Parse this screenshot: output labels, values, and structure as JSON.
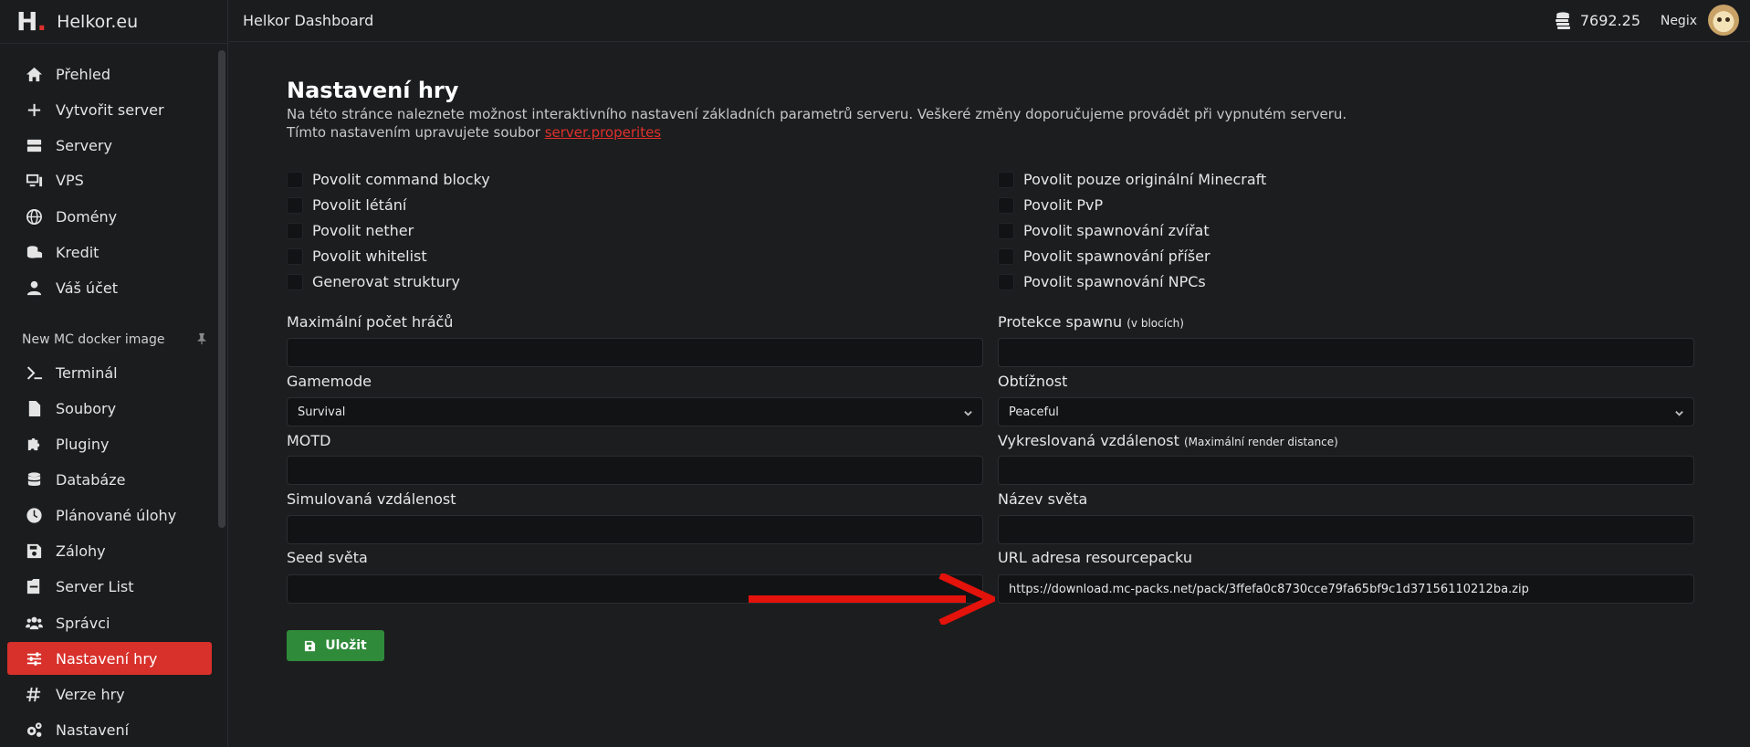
{
  "brand": {
    "logo_letter": "H",
    "logo_dot": ".",
    "name": "Helkor.eu"
  },
  "topbar": {
    "title": "Helkor Dashboard",
    "credit": "7692.25",
    "username": "Negix"
  },
  "sidebar": {
    "items": [
      {
        "label": "Přehled",
        "icon": "home-icon"
      },
      {
        "label": "Vytvořit server",
        "icon": "plus-icon"
      },
      {
        "label": "Servery",
        "icon": "server-icon"
      },
      {
        "label": "VPS",
        "icon": "desktop-icon"
      },
      {
        "label": "Domény",
        "icon": "globe-icon"
      },
      {
        "label": "Kredit",
        "icon": "coins-icon"
      },
      {
        "label": "Váš účet",
        "icon": "user-icon"
      }
    ],
    "section_label": "New MC docker image",
    "server_items": [
      {
        "label": "Terminál",
        "icon": "terminal-icon"
      },
      {
        "label": "Soubory",
        "icon": "file-icon"
      },
      {
        "label": "Pluginy",
        "icon": "puzzle-icon"
      },
      {
        "label": "Databáze",
        "icon": "database-icon"
      },
      {
        "label": "Plánované úlohy",
        "icon": "clock-icon"
      },
      {
        "label": "Zálohy",
        "icon": "save-icon"
      },
      {
        "label": "Server List",
        "icon": "list-icon"
      },
      {
        "label": "Správci",
        "icon": "users-icon"
      },
      {
        "label": "Nastavení hry",
        "icon": "sliders-icon",
        "active": true
      },
      {
        "label": "Verze hry",
        "icon": "hashtag-icon"
      },
      {
        "label": "Nastavení",
        "icon": "cogs-icon"
      }
    ],
    "active_color": "#d8302b"
  },
  "main": {
    "title": "Nastavení hry",
    "desc1": "Na této stránce naleznete možnost interaktivního nastavení základních parametrů serveru. Veškeré změny doporučujeme provádět při vypnutém serveru.",
    "desc2_prefix": "Tímto nastavením upravujete soubor ",
    "desc2_link": "server.properites",
    "checkboxes_left": [
      "Povolit command blocky",
      "Povolit létání",
      "Povolit nether",
      "Povolit whitelist",
      "Generovat struktury"
    ],
    "checkboxes_right": [
      "Povolit pouze originální Minecraft",
      "Povolit PvP",
      "Povolit spawnování zvířat",
      "Povolit spawnování příšer",
      "Povolit spawnování NPCs"
    ],
    "fields": {
      "max_players": {
        "label": "Maximální počet hráčů",
        "value": ""
      },
      "spawn_protection": {
        "label": "Protekce spawnu",
        "hint": "(v blocích)",
        "value": ""
      },
      "gamemode": {
        "label": "Gamemode",
        "value": "Survival"
      },
      "difficulty": {
        "label": "Obtížnost",
        "value": "Peaceful"
      },
      "motd": {
        "label": "MOTD",
        "value": ""
      },
      "view_distance": {
        "label": "Vykreslovaná vzdálenost",
        "hint": "(Maximální render distance)",
        "value": ""
      },
      "simulation_distance": {
        "label": "Simulovaná vzdálenost",
        "value": ""
      },
      "world_name": {
        "label": "Název světa",
        "value": ""
      },
      "seed": {
        "label": "Seed světa",
        "value": ""
      },
      "resourcepack_url": {
        "label": "URL adresa resourcepacku",
        "value": "https://download.mc-packs.net/pack/3ffefa0c8730cce79fa65bf9c1d37156110212ba.zip"
      }
    },
    "save_label": "Uložit",
    "save_color": "#2f8a3a",
    "annotation_arrow_color": "#e3120b"
  }
}
